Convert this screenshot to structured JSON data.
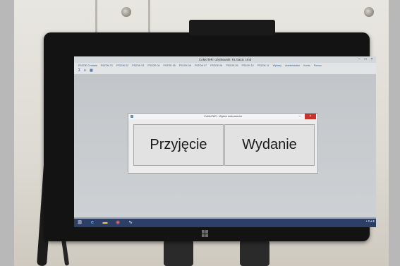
{
  "app": {
    "window_title": "CoMoTeR: użytkownik: KL baza: cmd",
    "menu": [
      "PSZOK Centrala",
      "PSZOK 01",
      "PSZOK 02",
      "PSZOK 03",
      "PSZOK 04",
      "PSZOK 05",
      "PSZOK 06",
      "PSZOK 07",
      "PSZOK 08",
      "PSZOK 09",
      "PSZOK 10",
      "PSZOK 11",
      "Wykazy",
      "Administrator",
      "Konto",
      "Pomoc"
    ],
    "toolbar_icons": [
      "sigma-icon",
      "list-icon",
      "grid-icon"
    ]
  },
  "dialog": {
    "title": "CoMoTeR - Wybór dokumentu",
    "buttons": [
      {
        "label": "Przyjęcie",
        "name": "przyjecie-button"
      },
      {
        "label": "Wydanie",
        "name": "wydanie-button"
      }
    ]
  },
  "taskbar": {
    "items": [
      "windows-start-icon",
      "internet-explorer-icon",
      "file-explorer-icon",
      "app-icon",
      "chart-icon"
    ],
    "accent": "#2d3e67"
  },
  "colors": {
    "bezel": "#131313",
    "dialog_close": "#c8322b",
    "menu_text": "#2a5d9e"
  }
}
